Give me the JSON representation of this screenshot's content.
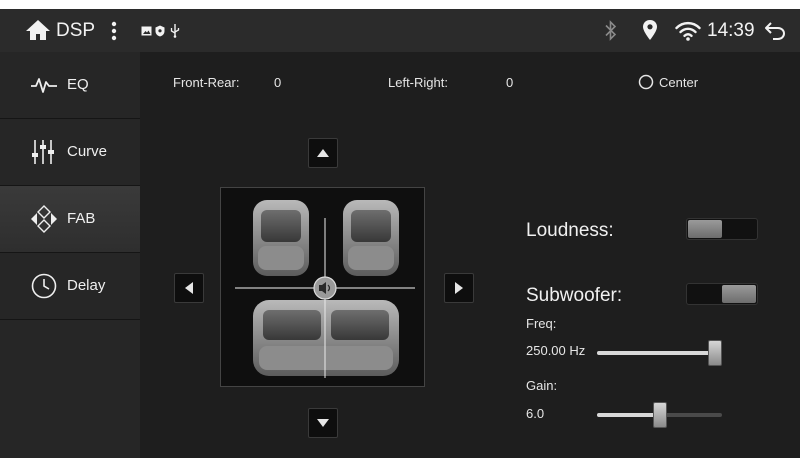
{
  "status_bar": {
    "app_title": "DSP",
    "time": "14:39"
  },
  "sidebar": {
    "items": [
      {
        "label": "EQ"
      },
      {
        "label": "Curve"
      },
      {
        "label": "FAB"
      },
      {
        "label": "Delay"
      }
    ],
    "active_item": "FAB"
  },
  "balance": {
    "front_rear_label": "Front-Rear:",
    "front_rear_value": "0",
    "left_right_label": "Left-Right:",
    "left_right_value": "0",
    "center_label": "Center"
  },
  "loudness": {
    "label": "Loudness:",
    "enabled": false
  },
  "subwoofer": {
    "label": "Subwoofer:",
    "enabled": true,
    "freq_label": "Freq:",
    "freq_value": "250.00 Hz",
    "freq_level": 1.0,
    "gain_label": "Gain:",
    "gain_value": "6.0",
    "gain_level": 0.5
  },
  "colors": {
    "background": "#1e1e1e",
    "status_bar": "#2b2b2b",
    "sidebar": "#262626",
    "text": "#e8e8e8"
  }
}
